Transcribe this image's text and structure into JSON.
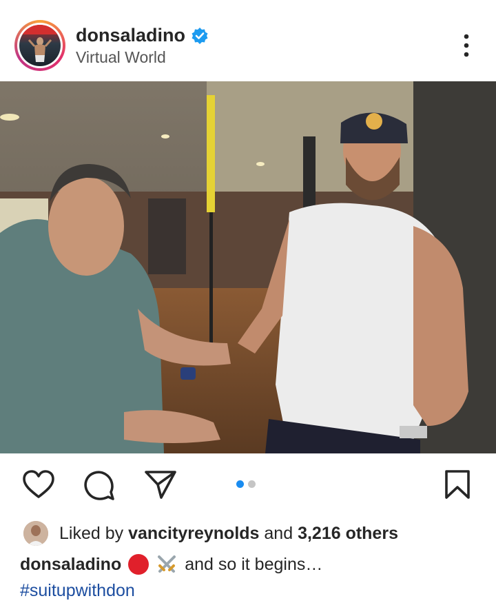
{
  "post": {
    "username": "donsaladino",
    "location": "Virtual World",
    "verified": true
  },
  "media": {
    "carousel_count": 2,
    "active_index": 1
  },
  "likes": {
    "prefix": "Liked by",
    "by_user": "vancityreynolds",
    "conjunction": "and",
    "others": "3,216 others"
  },
  "caption": {
    "username": "donsaladino",
    "text": "and so it begins…",
    "hashtag": "#suitupwithdon"
  },
  "icons": {
    "like": "heart-icon",
    "comment": "comment-icon",
    "share": "send-icon",
    "save": "bookmark-icon",
    "more": "more-icon"
  },
  "colors": {
    "verified": "#1d9bf0",
    "hashtag": "#1d4ea0",
    "carousel_active": "#1a8cf0"
  }
}
